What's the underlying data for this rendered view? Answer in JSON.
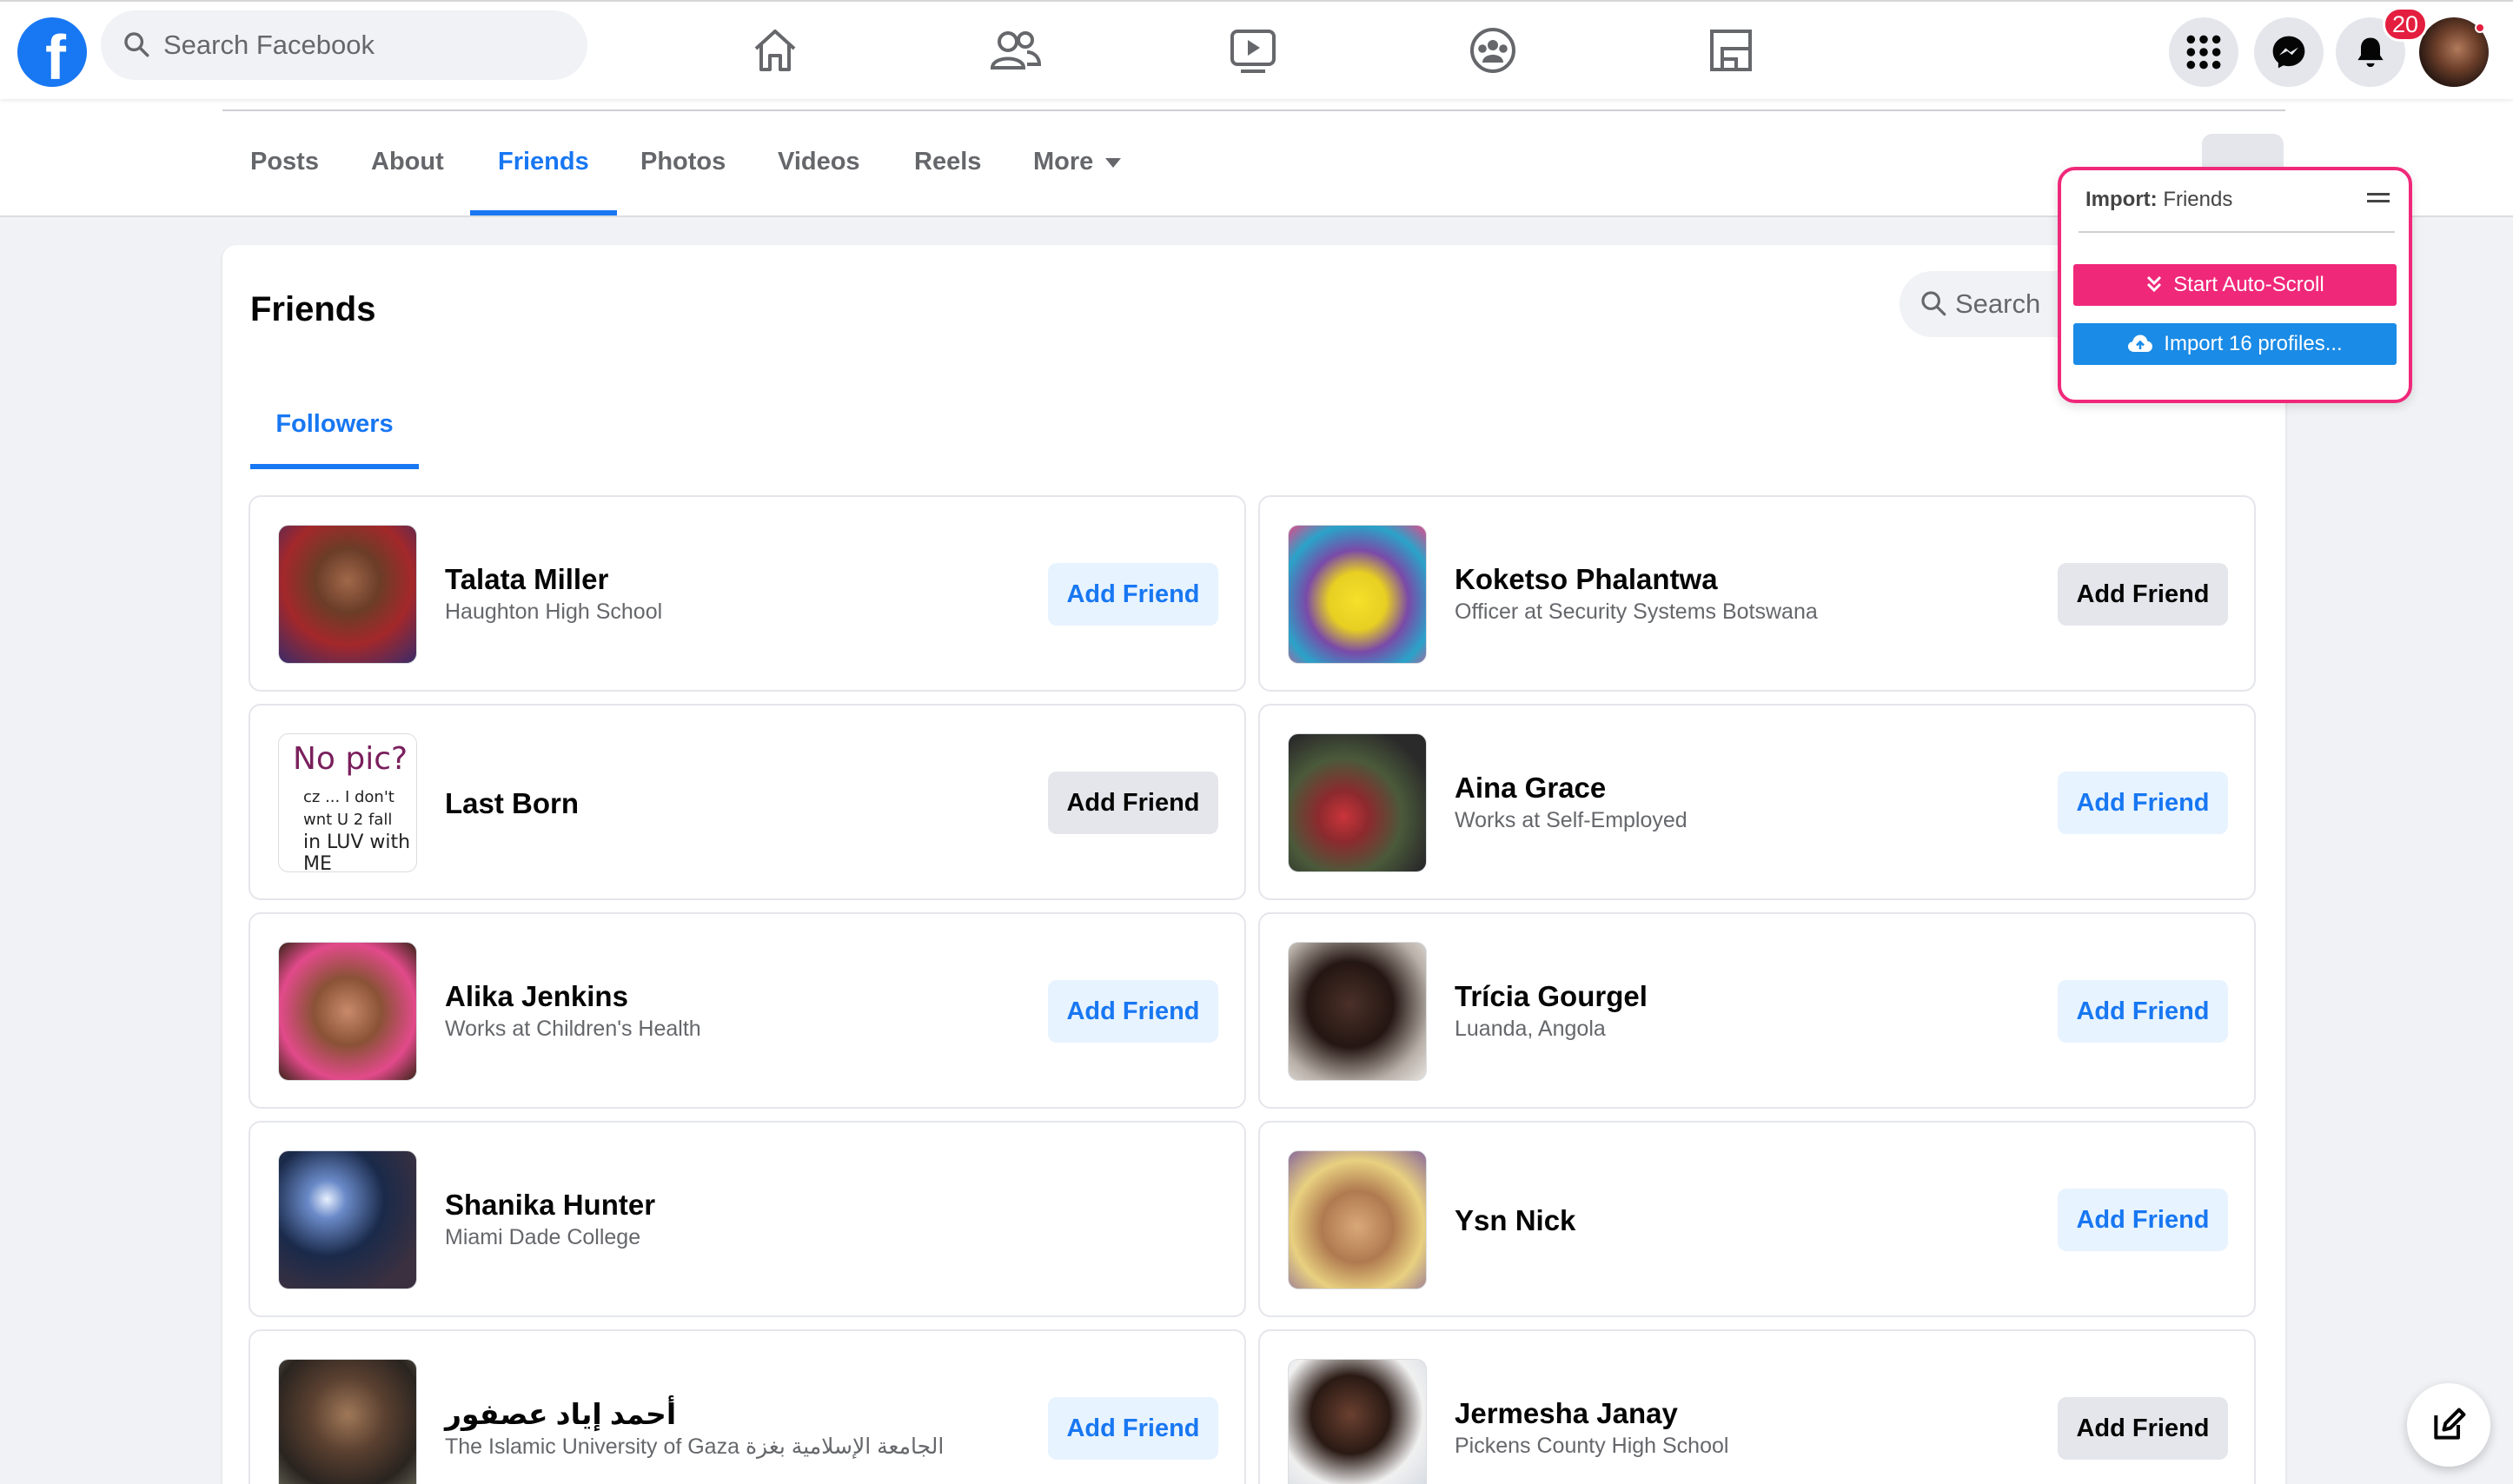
{
  "topnav": {
    "logo_letter": "f",
    "search_placeholder": "Search Facebook",
    "notification_count": "20"
  },
  "profile_tabs": {
    "items": [
      "Posts",
      "About",
      "Friends",
      "Photos",
      "Videos",
      "Reels",
      "More"
    ],
    "active": "Friends",
    "ellipsis": "..."
  },
  "friends_section": {
    "title": "Friends",
    "search_placeholder": "Search",
    "tab": "Followers",
    "friends": [
      {
        "name": "Talata Miller",
        "subtitle": "Haughton High School",
        "button": "Add Friend",
        "style": "blue"
      },
      {
        "name": "Koketso Phalantwa",
        "subtitle": "Officer at Security Systems Botswana",
        "button": "Add Friend",
        "style": "gray"
      },
      {
        "name": "Last Born",
        "subtitle": "",
        "button": "Add Friend",
        "style": "gray"
      },
      {
        "name": "Aina Grace",
        "subtitle": "Works at Self-Employed",
        "button": "Add Friend",
        "style": "blue"
      },
      {
        "name": "Alika Jenkins",
        "subtitle": "Works at Children's Health",
        "button": "Add Friend",
        "style": "blue"
      },
      {
        "name": "Trícia Gourgel",
        "subtitle": "Luanda, Angola",
        "button": "Add Friend",
        "style": "blue"
      },
      {
        "name": "Shanika Hunter",
        "subtitle": "Miami Dade College",
        "button": "",
        "style": "none"
      },
      {
        "name": "Ysn Nick",
        "subtitle": "",
        "button": "Add Friend",
        "style": "blue"
      },
      {
        "name": "أحمد إياد عصفور",
        "subtitle": "The Islamic University of Gaza الجامعة الإسلامية بغزة",
        "button": "Add Friend",
        "style": "blue"
      },
      {
        "name": "Jermesha Janay",
        "subtitle": "Pickens County High School",
        "button": "Add Friend",
        "style": "gray"
      }
    ],
    "nopic_text": {
      "line1": "No pic?",
      "line2": "cz ... I don't wnt U 2 fall",
      "line3": "in LUV with ME"
    }
  },
  "import_widget": {
    "title_bold": "Import:",
    "title_rest": " Friends",
    "autoscroll_label": "Start Auto-Scroll",
    "import_label": "Import 16 profiles..."
  },
  "colors": {
    "facebook_blue": "#1877f2",
    "widget_pink": "#f0287a",
    "widget_blue": "#1a8be6",
    "badge_red": "#e41e3f"
  },
  "icons": [
    "search-icon",
    "home-icon",
    "friends-icon",
    "watch-icon",
    "groups-icon",
    "gaming-icon",
    "menu-grid-icon",
    "messenger-icon",
    "bell-icon",
    "chevron-double-down-icon",
    "cloud-upload-icon",
    "compose-icon",
    "hamburger-icon",
    "caret-down-icon"
  ]
}
